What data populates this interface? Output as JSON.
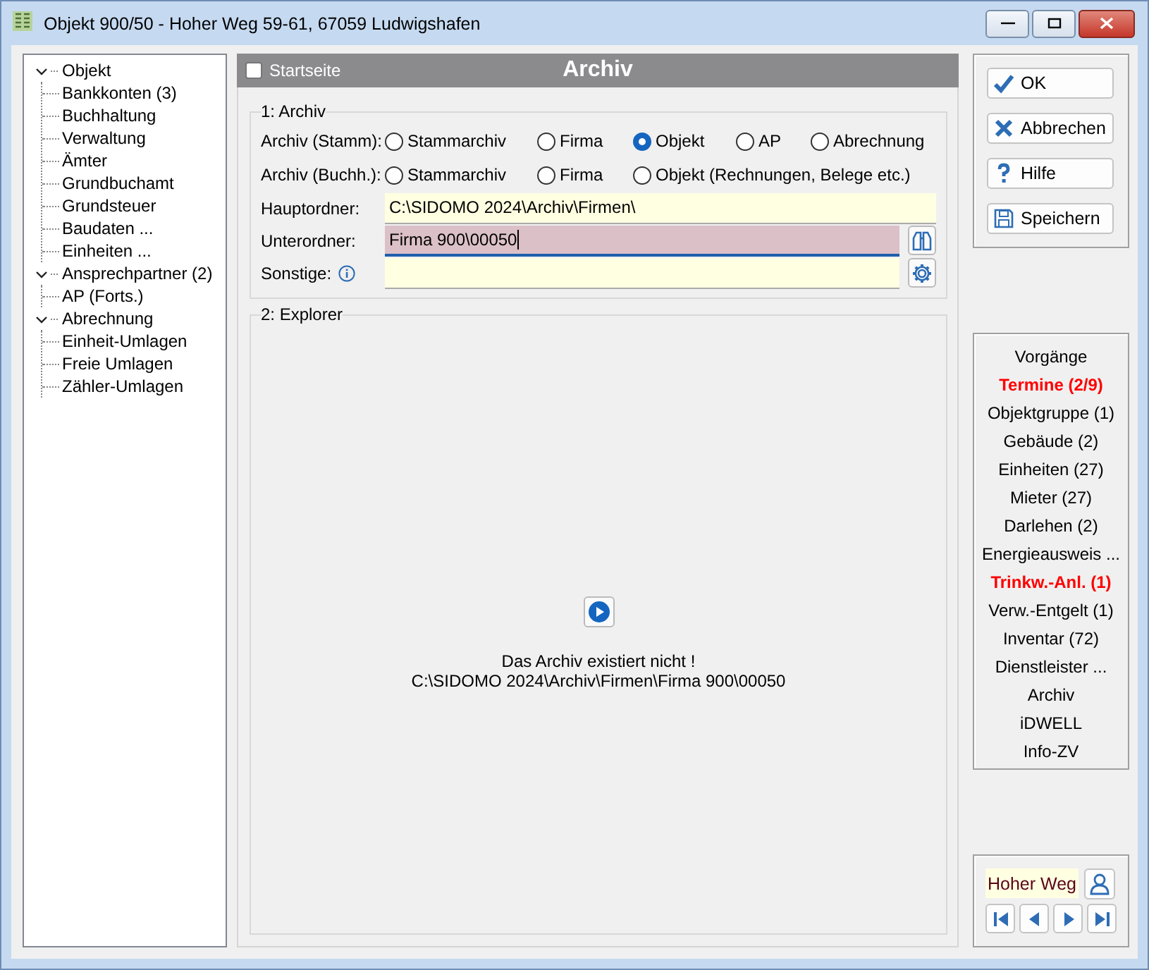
{
  "window": {
    "title": "Objekt 900/50 - Hoher Weg 59-61, 67059 Ludwigshafen"
  },
  "tree": [
    {
      "label": "Objekt",
      "expanded": true,
      "children": [
        {
          "label": "Bankkonten (3)"
        },
        {
          "label": "Buchhaltung"
        },
        {
          "label": "Verwaltung"
        },
        {
          "label": "Ämter"
        },
        {
          "label": "Grundbuchamt"
        },
        {
          "label": "Grundsteuer"
        },
        {
          "label": "Baudaten ..."
        },
        {
          "label": "Einheiten ..."
        }
      ]
    },
    {
      "label": "Ansprechpartner (2)",
      "expanded": true,
      "children": [
        {
          "label": "AP (Forts.)"
        }
      ]
    },
    {
      "label": "Abrechnung",
      "expanded": true,
      "children": [
        {
          "label": "Einheit-Umlagen"
        },
        {
          "label": "Freie Umlagen"
        },
        {
          "label": "Zähler-Umlagen"
        }
      ]
    }
  ],
  "header": {
    "checkbox_label": "Startseite",
    "checked": false,
    "title": "Archiv"
  },
  "archive_group": {
    "legend": "1: Archiv",
    "radio_rows": [
      {
        "label": "Archiv (Stamm):",
        "options": [
          {
            "label": "Stammarchiv",
            "selected": false
          },
          {
            "label": "Firma",
            "selected": false
          },
          {
            "label": "Objekt",
            "selected": true
          },
          {
            "label": "AP",
            "selected": false
          },
          {
            "label": "Abrechnung",
            "selected": false
          }
        ]
      },
      {
        "label": "Archiv (Buchh.):",
        "options": [
          {
            "label": "Stammarchiv",
            "selected": false
          },
          {
            "label": "Firma",
            "selected": false
          },
          {
            "label": "Objekt (Rechnungen, Belege etc.)",
            "selected": false
          }
        ]
      }
    ],
    "fields": [
      {
        "label": "Hauptordner:",
        "kind": "plain",
        "info": false,
        "focused": false,
        "value": "C:\\SIDOMO 2024\\Archiv\\Firmen\\"
      },
      {
        "label": "Unterordner:",
        "kind": "browse",
        "info": false,
        "focused": true,
        "value": "Firma 900\\00050"
      },
      {
        "label": "Sonstige:",
        "kind": "settings",
        "info": true,
        "focused": false
      }
    ]
  },
  "explorer_group": {
    "legend": "2: Explorer",
    "message": "Das Archiv existiert nicht !",
    "path": "C:\\SIDOMO 2024\\Archiv\\Firmen\\Firma 900\\00050"
  },
  "buttons": [
    {
      "label": "OK",
      "kind": "ok"
    },
    {
      "label": "Abbrechen",
      "kind": "cancel"
    },
    {
      "label": "Hilfe",
      "kind": "help"
    },
    {
      "label": "Speichern",
      "kind": "save"
    }
  ],
  "nav_items": [
    {
      "label": "Vorgänge",
      "alert": false
    },
    {
      "label": "Termine (2/9)",
      "alert": true
    },
    {
      "label": "Objektgruppe (1)",
      "alert": false
    },
    {
      "label": "Gebäude (2)",
      "alert": false
    },
    {
      "label": "Einheiten (27)",
      "alert": false
    },
    {
      "label": "Mieter (27)",
      "alert": false
    },
    {
      "label": "Darlehen (2)",
      "alert": false
    },
    {
      "label": "Energieausweis ...",
      "alert": false
    },
    {
      "label": "Trinkw.-Anl. (1)",
      "alert": true
    },
    {
      "label": "Verw.-Entgelt (1)",
      "alert": false
    },
    {
      "label": "Inventar (72)",
      "alert": false
    },
    {
      "label": "Dienstleister ...",
      "alert": false
    },
    {
      "label": "Archiv",
      "alert": false
    },
    {
      "label": "iDWELL",
      "alert": false
    },
    {
      "label": "Info-ZV",
      "alert": false
    }
  ],
  "record_nav": {
    "value": "Hoher Weg"
  }
}
